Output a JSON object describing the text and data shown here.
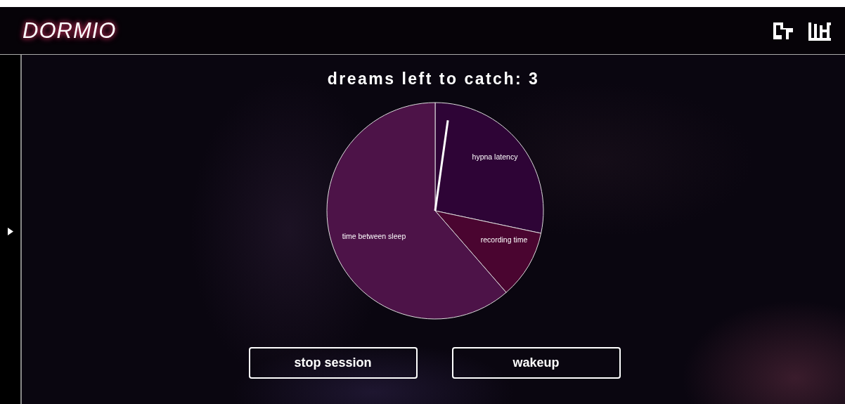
{
  "header": {
    "logo": "DORMIO"
  },
  "title": "dreams left to catch: 3",
  "pie": {
    "slices": [
      {
        "label": "hypna latency",
        "color": "#2e0436"
      },
      {
        "label": "recording time",
        "color": "#4a0530"
      },
      {
        "label": "time between sleep",
        "color": "#4d1348"
      }
    ]
  },
  "buttons": [
    "stop session",
    "wakeup"
  ]
}
